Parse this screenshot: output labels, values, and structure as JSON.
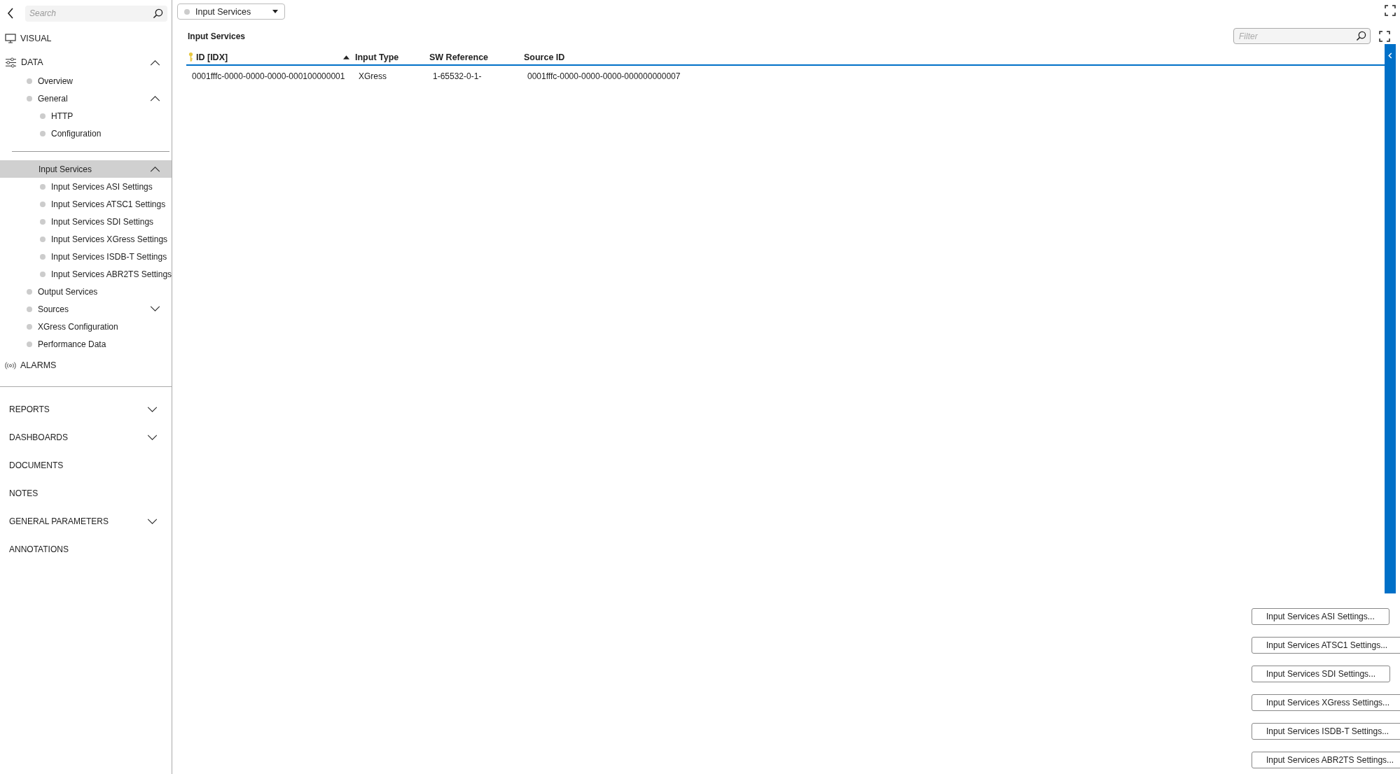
{
  "sidebar": {
    "search": {
      "placeholder": "Search"
    },
    "nav_top": [
      {
        "label": "VISUAL",
        "kind": "visual"
      },
      {
        "label": "DATA",
        "kind": "data",
        "expanded": true
      }
    ],
    "tree": [
      {
        "label": "Overview",
        "selected": false
      },
      {
        "label": "General",
        "selected": false,
        "expanded": true,
        "children": [
          {
            "label": "HTTP",
            "selected": false
          },
          {
            "label": "Configuration",
            "selected": false
          }
        ]
      },
      {
        "label": "Input Services",
        "selected": true,
        "expanded": true,
        "children": [
          {
            "label": "Input Services ASI Settings",
            "selected": false
          },
          {
            "label": "Input Services ATSC1 Settings",
            "selected": false
          },
          {
            "label": "Input Services SDI Settings",
            "selected": false
          },
          {
            "label": "Input Services XGress Settings",
            "selected": false
          },
          {
            "label": "Input Services ISDB-T Settings",
            "selected": false
          },
          {
            "label": "Input Services ABR2TS Settings",
            "selected": false
          }
        ]
      },
      {
        "label": "Output Services",
        "selected": false
      },
      {
        "label": "Sources",
        "selected": false,
        "expanded": false
      },
      {
        "label": "XGress Configuration",
        "selected": false
      },
      {
        "label": "Performance Data",
        "selected": false
      }
    ],
    "alarms": {
      "label": "ALARMS"
    },
    "nav_bottom": [
      {
        "label": "REPORTS",
        "expanded": false
      },
      {
        "label": "DASHBOARDS",
        "expanded": false
      },
      {
        "label": "DOCUMENTS"
      },
      {
        "label": "NOTES"
      },
      {
        "label": "GENERAL PARAMETERS",
        "expanded": false
      },
      {
        "label": "ANNOTATIONS"
      }
    ]
  },
  "view_selector": {
    "value": "Input Services"
  },
  "table_title": "Input Services",
  "filter": {
    "placeholder": "Filter"
  },
  "table": {
    "columns": [
      {
        "label": "ID [IDX]",
        "key_icon": true,
        "sorted": true
      },
      {
        "label": "Input Type",
        "key_icon": false,
        "sorted": false
      },
      {
        "label": "SW Reference",
        "key_icon": false,
        "sorted": false
      },
      {
        "label": "Source ID",
        "key_icon": false,
        "sorted": false
      }
    ],
    "rows": [
      [
        "0001fffc-0000-0000-0000-000100000001",
        "XGress",
        "1-65532-0-1-",
        "0001fffc-0000-0000-0000-000000000007"
      ]
    ]
  },
  "buttons": [
    "Input Services ASI Settings...",
    "Input Services ATSC1 Settings...",
    "Input Services SDI Settings...",
    "Input Services XGress Settings...",
    "Input Services ISDB-T Settings...",
    "Input Services ABR2TS Settings..."
  ]
}
